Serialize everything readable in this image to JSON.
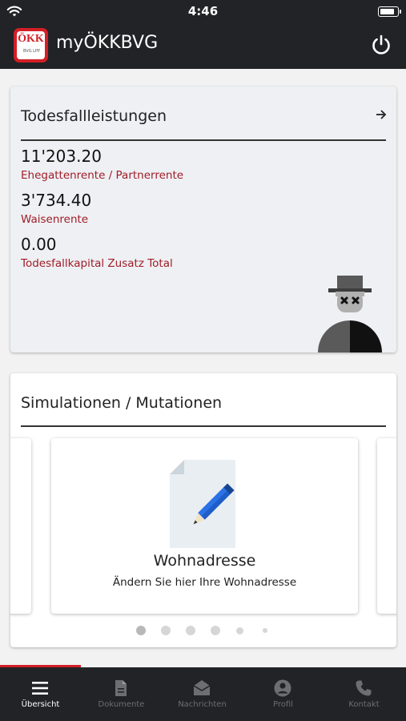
{
  "status_bar": {
    "time": "4:46",
    "battery_level": 0.9
  },
  "app_bar": {
    "logo_text": "ÖKK",
    "logo_subtext": "BVG LPP",
    "title": "myÖKKBVG",
    "power_icon": "power-icon"
  },
  "death_benefits": {
    "title": "Todesfallleistungen",
    "arrow_icon": "arrow-right-icon",
    "items": [
      {
        "amount": "11'203.20",
        "label": "Ehegattenrente / Partnerrente"
      },
      {
        "amount": "3'734.40",
        "label": "Waisenrente"
      },
      {
        "amount": "0.00",
        "label": "Todesfallkapital Zusatz Total"
      }
    ],
    "illustration": "deceased-figure-illustration"
  },
  "simulations": {
    "title": "Simulationen / Mutationen",
    "slides": [
      {
        "title": "Wohnadresse",
        "subtitle": "Ändern Sie hier Ihre Wohnadresse",
        "icon": "document-pencil-icon"
      }
    ],
    "pager": {
      "count": 6,
      "active_index": 0
    }
  },
  "tab_bar": {
    "active": "Übersicht",
    "tabs": [
      {
        "label": "Übersicht",
        "icon": "menu-icon"
      },
      {
        "label": "Dokumente",
        "icon": "document-icon"
      },
      {
        "label": "Nachrichten",
        "icon": "mail-icon"
      },
      {
        "label": "Profil",
        "icon": "profile-icon"
      },
      {
        "label": "Kontakt",
        "icon": "phone-icon"
      }
    ]
  },
  "colors": {
    "brand_red": "#d31f26",
    "label_red": "#a01c28",
    "dark_bar": "#222326",
    "inactive_tab": "#6d6e72"
  }
}
